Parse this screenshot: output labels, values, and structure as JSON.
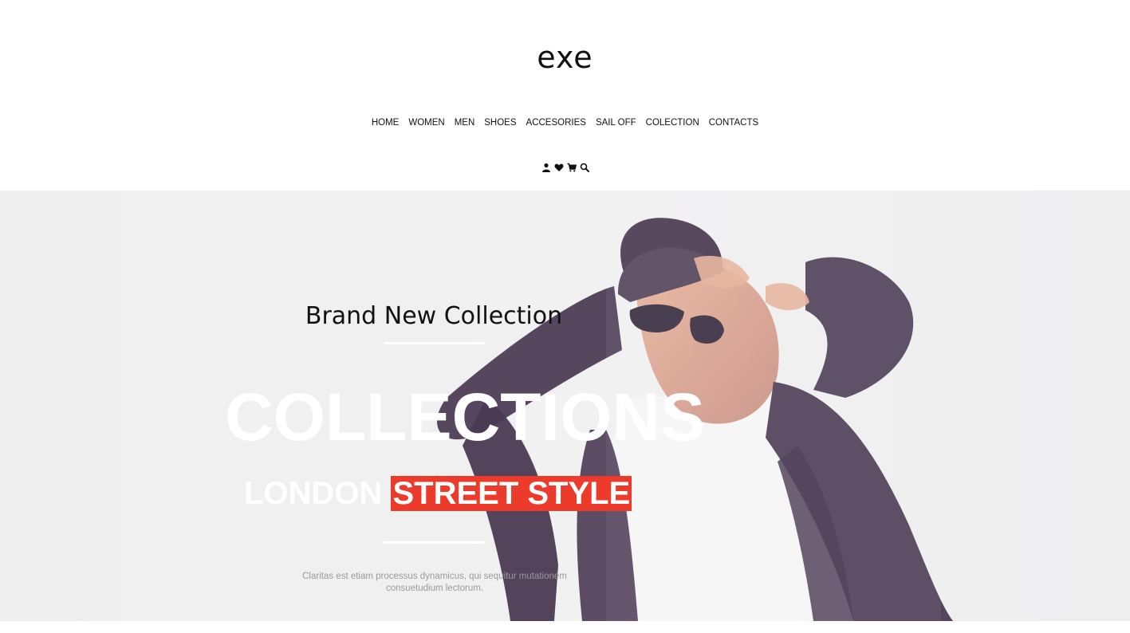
{
  "brand": {
    "logo": "exe"
  },
  "nav": {
    "items": [
      "HOME",
      "WOMEN",
      "MEN",
      "SHOES",
      "ACCESORIES",
      "SAIL OFF",
      "COLECTION",
      "CONTACTS"
    ]
  },
  "header_icons": [
    "user-icon",
    "heart-icon",
    "cart-icon",
    "search-icon"
  ],
  "hero": {
    "tagline": "Brand New Collection",
    "headline": "COLLECTIONS",
    "subline_plain": "LONDON",
    "subline_highlight": "STREET STYLE",
    "description": "Claritas est etiam processus dynamicus, qui sequitur mutationem consuetudium lectorum.",
    "highlight_color": "#ec3b2a",
    "background_color": "#eeeeee"
  }
}
